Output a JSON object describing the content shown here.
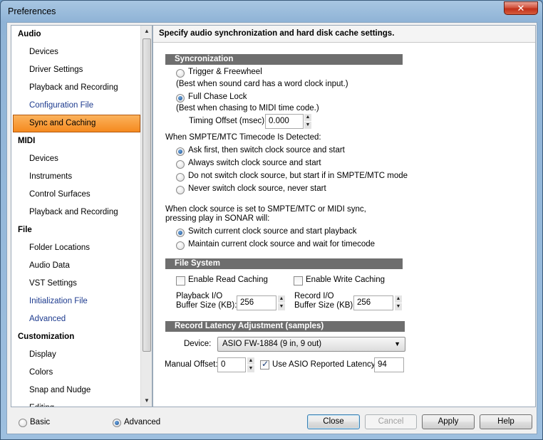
{
  "window": {
    "title": "Preferences",
    "close_glyph": "✕"
  },
  "sidebar": {
    "items": [
      {
        "label": "Audio",
        "type": "category"
      },
      {
        "label": "Devices",
        "type": "item"
      },
      {
        "label": "Driver Settings",
        "type": "item"
      },
      {
        "label": "Playback and Recording",
        "type": "item"
      },
      {
        "label": "Configuration File",
        "type": "link"
      },
      {
        "label": "Sync and Caching",
        "type": "selected"
      },
      {
        "label": "MIDI",
        "type": "category"
      },
      {
        "label": "Devices",
        "type": "item"
      },
      {
        "label": "Instruments",
        "type": "item"
      },
      {
        "label": "Control Surfaces",
        "type": "item"
      },
      {
        "label": "Playback and Recording",
        "type": "item"
      },
      {
        "label": "File",
        "type": "category"
      },
      {
        "label": "Folder Locations",
        "type": "item"
      },
      {
        "label": "Audio Data",
        "type": "item"
      },
      {
        "label": "VST Settings",
        "type": "item"
      },
      {
        "label": "Initialization File",
        "type": "link"
      },
      {
        "label": "Advanced",
        "type": "link"
      },
      {
        "label": "Customization",
        "type": "category"
      },
      {
        "label": "Display",
        "type": "item"
      },
      {
        "label": "Colors",
        "type": "item"
      },
      {
        "label": "Snap and Nudge",
        "type": "item"
      },
      {
        "label": "Editing",
        "type": "item"
      }
    ]
  },
  "header": {
    "description": "Specify audio synchronization and hard disk cache settings."
  },
  "sync": {
    "section_title": "Syncronization",
    "trigger_label": "Trigger & Freewheel",
    "trigger_note": "(Best when sound card has a word clock input.)",
    "chase_label": "Full Chase Lock",
    "chase_note": "(Best when chasing to MIDI time code.)",
    "timing_offset_label": "Timing Offset (msec):",
    "timing_offset_value": "0.000",
    "smpte_heading": "When SMPTE/MTC Timecode Is Detected:",
    "smpte_options": [
      "Ask first, then switch clock source and start",
      "Always switch clock source and start",
      "Do not switch clock source, but start if in SMPTE/MTC mode",
      "Never switch clock source, never start"
    ],
    "clock_heading_1": "When clock source is set to SMPTE/MTC or MIDI sync,",
    "clock_heading_2": "pressing play in SONAR will:",
    "clock_options": [
      "Switch current clock source and start playback",
      "Maintain current clock source and wait for timecode"
    ]
  },
  "filesystem": {
    "section_title": "File System",
    "read_caching_label": "Enable Read Caching",
    "write_caching_label": "Enable Write Caching",
    "playback_label_1": "Playback I/O",
    "playback_label_2": "Buffer Size (KB):",
    "playback_value": "256",
    "record_label_1": "Record I/O",
    "record_label_2": "Buffer Size (KB):",
    "record_value": "256"
  },
  "latency": {
    "section_title": "Record Latency Adjustment (samples)",
    "device_label": "Device:",
    "device_value": "ASIO FW-1884 (9 in, 9 out)",
    "manual_offset_label": "Manual Offset:",
    "manual_offset_value": "0",
    "asio_latency_label": "Use ASIO Reported Latency:",
    "asio_latency_value": "94"
  },
  "footer": {
    "basic_label": "Basic",
    "advanced_label": "Advanced",
    "close_label": "Close",
    "cancel_label": "Cancel",
    "apply_label": "Apply",
    "help_label": "Help"
  }
}
